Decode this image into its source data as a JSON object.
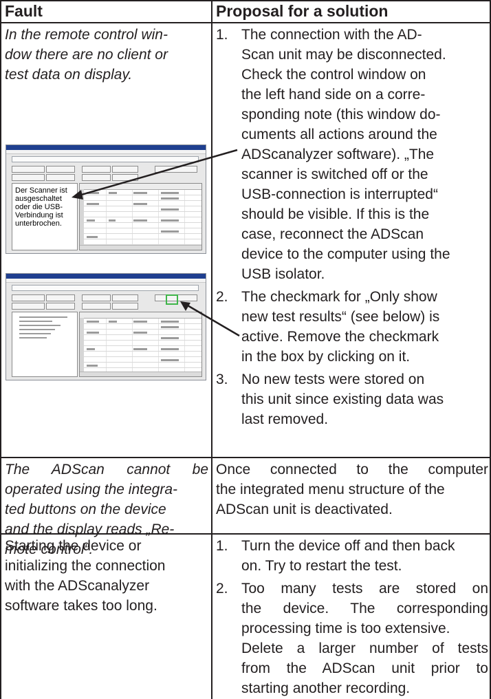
{
  "table": {
    "header": {
      "fault": "Fault",
      "solution": "Proposal for a solution"
    },
    "rows": [
      {
        "fault_lines": [
          "In the remote control win-",
          "dow there are no client or",
          "test data on display."
        ],
        "solutions": [
          {
            "num": "1.",
            "lines": [
              "The connection with the AD-",
              "Scan unit may be disconnected.",
              "Check the control window on",
              "the left hand side on a corre-",
              "sponding note (this window do-",
              "cuments all actions around the",
              "ADScanalyzer software). „The",
              "scanner is switched off or the",
              "USB-connection is interrupted“",
              "should be visible. If this is the",
              "case, reconnect the ADScan",
              "device to the computer using the",
              "USB isolator."
            ]
          },
          {
            "num": "2.",
            "lines": [
              "The checkmark for „Only show",
              "new test results“ (see below) is",
              "active. Remove the checkmark",
              "in the box by clicking on it."
            ]
          },
          {
            "num": "3.",
            "lines": [
              "No new tests were stored on",
              "this unit since  existing data was",
              "last removed."
            ]
          }
        ],
        "screenshot_note": "Der Scanner ist ausgeschaltet oder die USB-Verbindung ist unterbrochen."
      },
      {
        "fault_lines": [
          "The ADScan cannot be",
          "operated using the integra-",
          "ted buttons on the device",
          "and the display reads „Re-",
          "mote control“."
        ],
        "solution_lines": [
          "Once connected to the computer",
          "the integrated menu structure of the",
          "ADScan unit is deactivated."
        ]
      },
      {
        "fault_lines": [
          "Starting the device or",
          "initializing the connection",
          "with the ADScanalyzer",
          "software takes too long."
        ],
        "solutions": [
          {
            "num": "1.",
            "lines": [
              "Turn the device off and then back",
              "on. Try to restart the test."
            ]
          },
          {
            "num": "2.",
            "lines": [
              "Too many tests are stored on",
              "the device. The corresponding",
              "processing time is too extensive.",
              "Delete a larger number of tests",
              "from the ADScan unit prior to",
              "starting another recording."
            ]
          }
        ]
      }
    ]
  }
}
